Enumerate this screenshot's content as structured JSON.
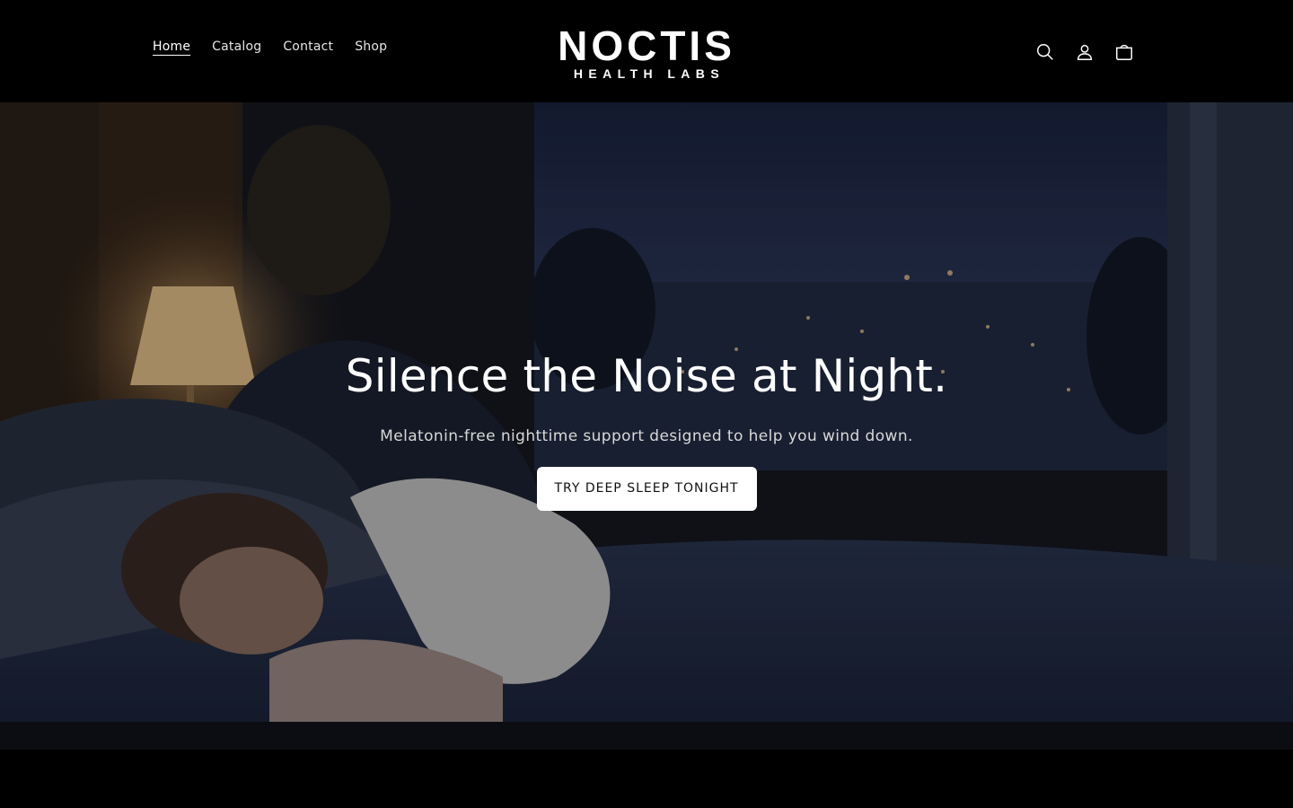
{
  "header": {
    "nav": [
      {
        "label": "Home",
        "active": true
      },
      {
        "label": "Catalog",
        "active": false
      },
      {
        "label": "Contact",
        "active": false
      },
      {
        "label": "Shop",
        "active": false
      }
    ],
    "logo": {
      "main": "NOCTIS",
      "sub": "HEALTH LABS"
    },
    "icons": [
      "search-icon",
      "account-icon",
      "cart-icon"
    ]
  },
  "hero": {
    "title": "Silence the Noise at Night.",
    "subtitle": "Melatonin-free nighttime support designed to help you wind down.",
    "cta_label": "TRY DEEP SLEEP TONIGHT"
  },
  "colors": {
    "background": "#000000",
    "text": "#ffffff",
    "button_bg": "#ffffff",
    "button_text": "#111111"
  }
}
